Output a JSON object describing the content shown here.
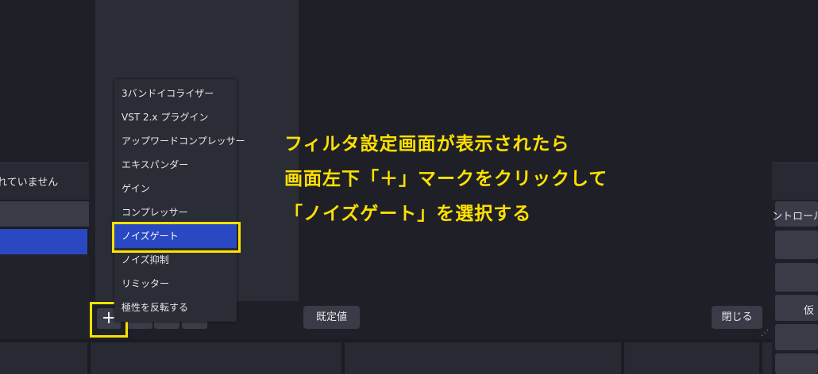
{
  "background": {
    "left_status": "れていません",
    "right_header": "ントロール",
    "right_button": "仮"
  },
  "filter_menu": {
    "items": [
      {
        "label": "3バンドイコライザー"
      },
      {
        "label": "VST 2.x プラグイン"
      },
      {
        "label": "アップワードコンプレッサー"
      },
      {
        "label": "エキスパンダー"
      },
      {
        "label": "ゲイン"
      },
      {
        "label": "コンプレッサー"
      },
      {
        "label": "ノイズゲート",
        "selected": true
      },
      {
        "label": "ノイズ抑制"
      },
      {
        "label": "リミッター"
      },
      {
        "label": "極性を反転する"
      }
    ]
  },
  "toolbar": {
    "add_label": "+",
    "defaults_label": "既定値",
    "close_label": "閉じる"
  },
  "annotation": {
    "line1": "フィルタ設定画面が表示されたら",
    "line2": "画面左下「＋」マークをクリックして",
    "line3": "「ノイズゲート」を選択する"
  },
  "colors": {
    "highlight": "#ffe100",
    "selection": "#2b48c3",
    "panel": "#2b2d36",
    "background": "#1f2027"
  }
}
